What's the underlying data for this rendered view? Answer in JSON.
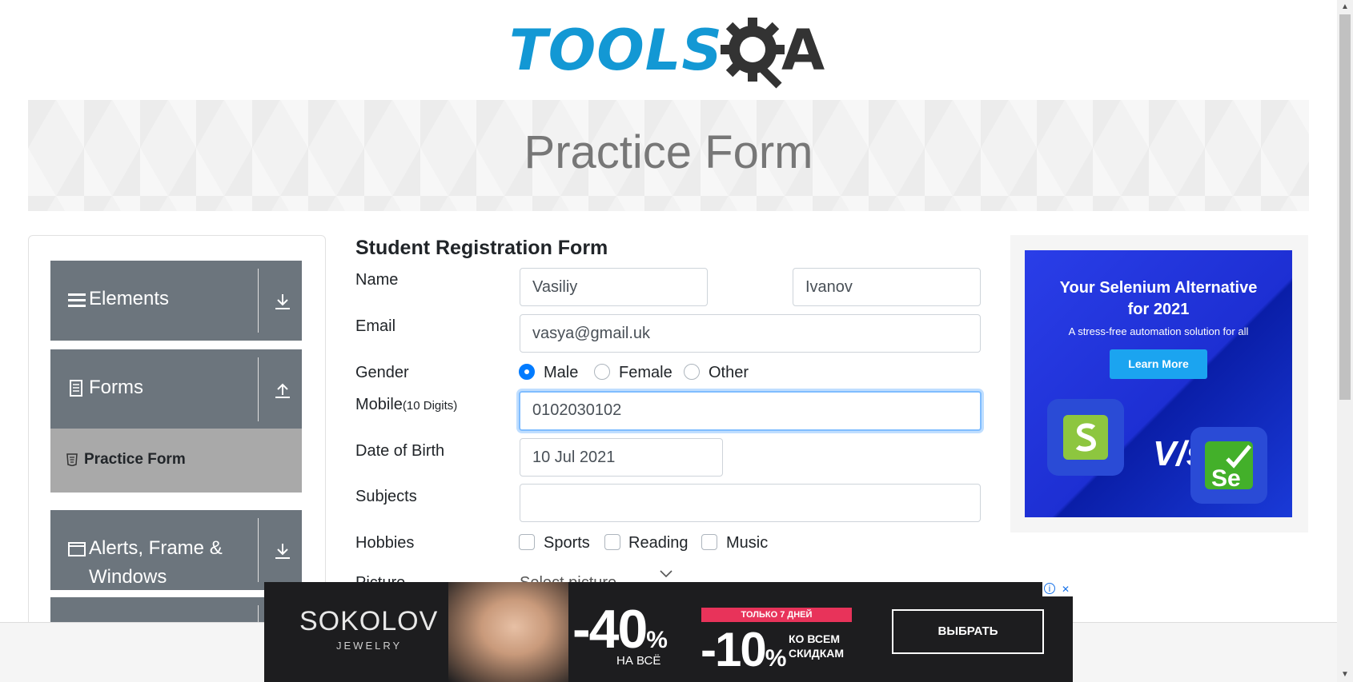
{
  "header": {
    "logo_text": "TOOLS",
    "logo_suffix": "A"
  },
  "banner": {
    "title": "Practice Form"
  },
  "sidebar": {
    "groups": [
      {
        "label": "Elements",
        "icon": "hamburger-icon",
        "arrow": "download-icon"
      },
      {
        "label": "Forms",
        "icon": "document-icon",
        "arrow": "upload-icon"
      },
      {
        "label": "Alerts, Frame & Windows",
        "label_line1": "Alerts, Frame &",
        "label_line2": "Windows",
        "icon": "window-icon",
        "arrow": "download-icon"
      }
    ],
    "active_item": {
      "label": "Practice Form",
      "icon": "html5-icon"
    }
  },
  "form": {
    "title": "Student Registration Form",
    "name_label": "Name",
    "first_name": "Vasiliy",
    "last_name": "Ivanov",
    "email_label": "Email",
    "email": "vasya@gmail.uk",
    "gender_label": "Gender",
    "gender_options": [
      "Male",
      "Female",
      "Other"
    ],
    "gender_selected": "Male",
    "mobile_label": "Mobile",
    "mobile_hint": "(10 Digits)",
    "mobile": "0102030102",
    "dob_label": "Date of Birth",
    "dob": "10 Jul 2021",
    "subjects_label": "Subjects",
    "subjects": "",
    "hobbies_label": "Hobbies",
    "hobbies_options": [
      "Sports",
      "Reading",
      "Music"
    ],
    "picture_label": "Picture",
    "picture_button": "Select picture"
  },
  "ad_right": {
    "headline_line1": "Your Selenium Alternative",
    "headline_line2": "for 2021",
    "subline": "A stress-free automation solution for all",
    "button": "Learn More",
    "vs": "V/s",
    "tile_right": "Se"
  },
  "ad_bottom": {
    "brand": "SOKOLOV",
    "brand_sub": "JEWELRY",
    "discount1": "-40",
    "discount1_pct": "%",
    "discount1_sub": "НА ВСЁ",
    "tag": "ТОЛЬКО 7 ДНЕЙ",
    "discount2": "-10",
    "discount2_pct": "%",
    "discount2_line1": "КО ВСЕМ",
    "discount2_line2": "СКИДКАМ",
    "cta": "ВЫБРАТЬ",
    "info": "i",
    "close": "✕"
  },
  "colors": {
    "brand_blue": "#1398d4",
    "sidebar_group": "#6c757d",
    "sidebar_active": "#a9a9a9",
    "radio_checked": "#007bff",
    "focus_ring": "#80bdff"
  }
}
